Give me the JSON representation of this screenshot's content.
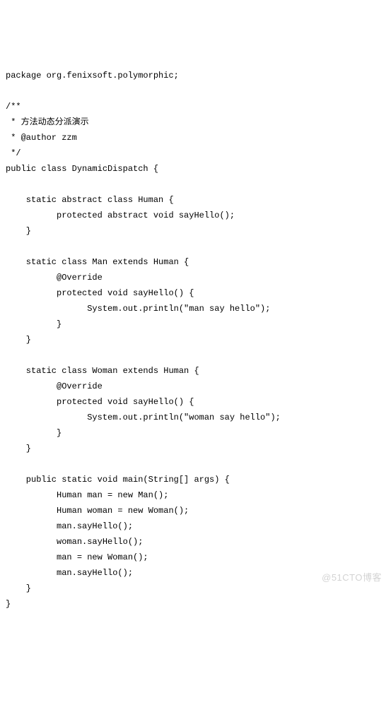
{
  "code": {
    "lines": [
      "package org.fenixsoft.polymorphic;",
      "",
      "/**",
      " * 方法动态分派演示",
      " * @author zzm",
      " */",
      "public class DynamicDispatch {",
      "",
      "    static abstract class Human {",
      "          protected abstract void sayHello();",
      "    }",
      "",
      "    static class Man extends Human {",
      "          @Override",
      "          protected void sayHello() {",
      "                System.out.println(\"man say hello\");",
      "          }",
      "    }",
      "",
      "    static class Woman extends Human {",
      "          @Override",
      "          protected void sayHello() {",
      "                System.out.println(\"woman say hello\");",
      "          }",
      "    }",
      "",
      "    public static void main(String[] args) {",
      "          Human man = new Man();",
      "          Human woman = new Woman();",
      "          man.sayHello();",
      "          woman.sayHello();",
      "          man = new Woman();",
      "          man.sayHello();",
      "    }",
      "}"
    ]
  },
  "watermark": "@51CTO博客"
}
